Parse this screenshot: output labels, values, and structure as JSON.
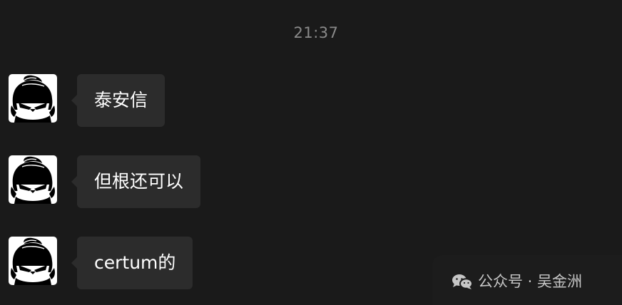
{
  "chat": {
    "timestamp": "21:37",
    "messages": [
      {
        "text": "泰安信",
        "avatar_icon": "cartoon-face-avatar-icon"
      },
      {
        "text": "但根还可以",
        "avatar_icon": "cartoon-face-avatar-icon"
      },
      {
        "text": "certum的",
        "avatar_icon": "cartoon-face-avatar-icon"
      }
    ]
  },
  "watermark": {
    "icon": "wechat-icon",
    "text": "公众号 · 吴金洲"
  },
  "colors": {
    "background": "#1a1a1a",
    "bubble": "#2c2c2c",
    "bubble_text": "#ffffff",
    "timestamp": "#8a8a8a",
    "watermark_text": "#c6c6c6"
  }
}
